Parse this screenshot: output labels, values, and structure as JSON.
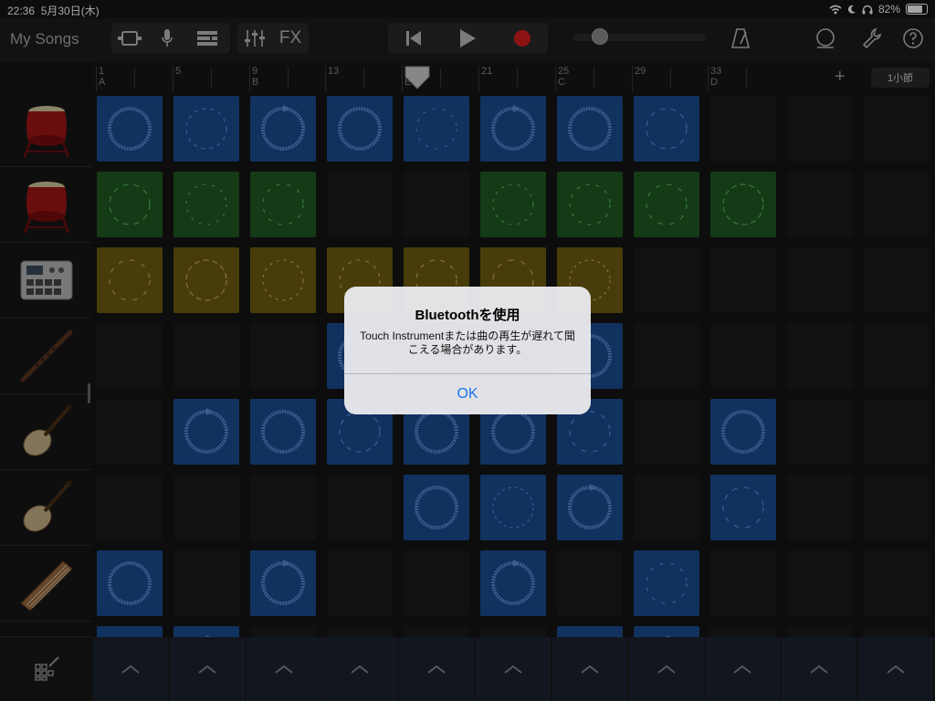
{
  "status_bar": {
    "time": "22:36",
    "date": "5月30日(木)",
    "battery": "82%",
    "battery_level": 0.82
  },
  "toolbar": {
    "my_songs": "My Songs",
    "fx_label": "FX",
    "colors": {
      "record": "#d81e1e"
    },
    "icons": [
      "view-toggle-icon",
      "microphone-icon",
      "tracks-view-icon",
      "mixer-icon",
      "rewind-icon",
      "play-icon",
      "record-icon",
      "metronome-icon",
      "loop-browser-icon",
      "settings-wrench-icon",
      "help-icon"
    ],
    "volume": 0.2
  },
  "ruler": {
    "bar_button": "1小節",
    "add_label": "+",
    "marks": [
      {
        "num": "1",
        "sec": "A"
      },
      {
        "num": "5",
        "sec": ""
      },
      {
        "num": "9",
        "sec": "B"
      },
      {
        "num": "13",
        "sec": ""
      },
      {
        "num": "17",
        "sec": "E"
      },
      {
        "num": "21",
        "sec": ""
      },
      {
        "num": "25",
        "sec": "C"
      },
      {
        "num": "29",
        "sec": ""
      },
      {
        "num": "33",
        "sec": "D"
      }
    ]
  },
  "instruments": [
    {
      "name": "taiko-drum-1",
      "icon": "taiko-drum-icon"
    },
    {
      "name": "taiko-drum-2",
      "icon": "taiko-drum-icon"
    },
    {
      "name": "beat-sequencer",
      "icon": "drum-machine-icon"
    },
    {
      "name": "shakuhachi",
      "icon": "flute-icon"
    },
    {
      "name": "biwa-1",
      "icon": "biwa-icon"
    },
    {
      "name": "biwa-2",
      "icon": "biwa-icon"
    },
    {
      "name": "koto",
      "icon": "koto-icon"
    }
  ],
  "grid": {
    "colors": {
      "blue": "#1b4d93",
      "green": "#1f5a22",
      "yellow": "#6f5f10",
      "empty": "#1b1b1b"
    },
    "rows": [
      [
        "blue",
        "blue",
        "blue",
        "blue",
        "blue",
        "blue",
        "blue",
        "blue",
        "empty",
        "empty",
        "empty"
      ],
      [
        "green",
        "green",
        "green",
        "empty",
        "empty",
        "green",
        "green",
        "green",
        "green",
        "empty",
        "empty"
      ],
      [
        "yellow",
        "yellow",
        "yellow",
        "yellow",
        "yellow",
        "yellow",
        "yellow",
        "empty",
        "empty",
        "empty",
        "empty"
      ],
      [
        "empty",
        "empty",
        "empty",
        "blue",
        "empty",
        "empty",
        "blue",
        "empty",
        "empty",
        "empty",
        "empty"
      ],
      [
        "empty",
        "blue",
        "blue",
        "blue",
        "blue",
        "blue",
        "blue",
        "empty",
        "blue",
        "empty",
        "empty"
      ],
      [
        "empty",
        "empty",
        "empty",
        "empty",
        "blue",
        "blue",
        "blue",
        "empty",
        "blue",
        "empty",
        "empty"
      ],
      [
        "blue",
        "empty",
        "blue",
        "empty",
        "empty",
        "blue",
        "empty",
        "blue",
        "empty",
        "empty",
        "empty"
      ],
      [
        "blue",
        "blue",
        "empty",
        "empty",
        "empty",
        "empty",
        "blue",
        "blue",
        "empty",
        "empty",
        "empty"
      ]
    ]
  },
  "alert": {
    "title": "Bluetoothを使用",
    "message": "Touch Instrumentまたは曲の再生が遅れて聞こえる場合があります。",
    "ok": "OK"
  }
}
